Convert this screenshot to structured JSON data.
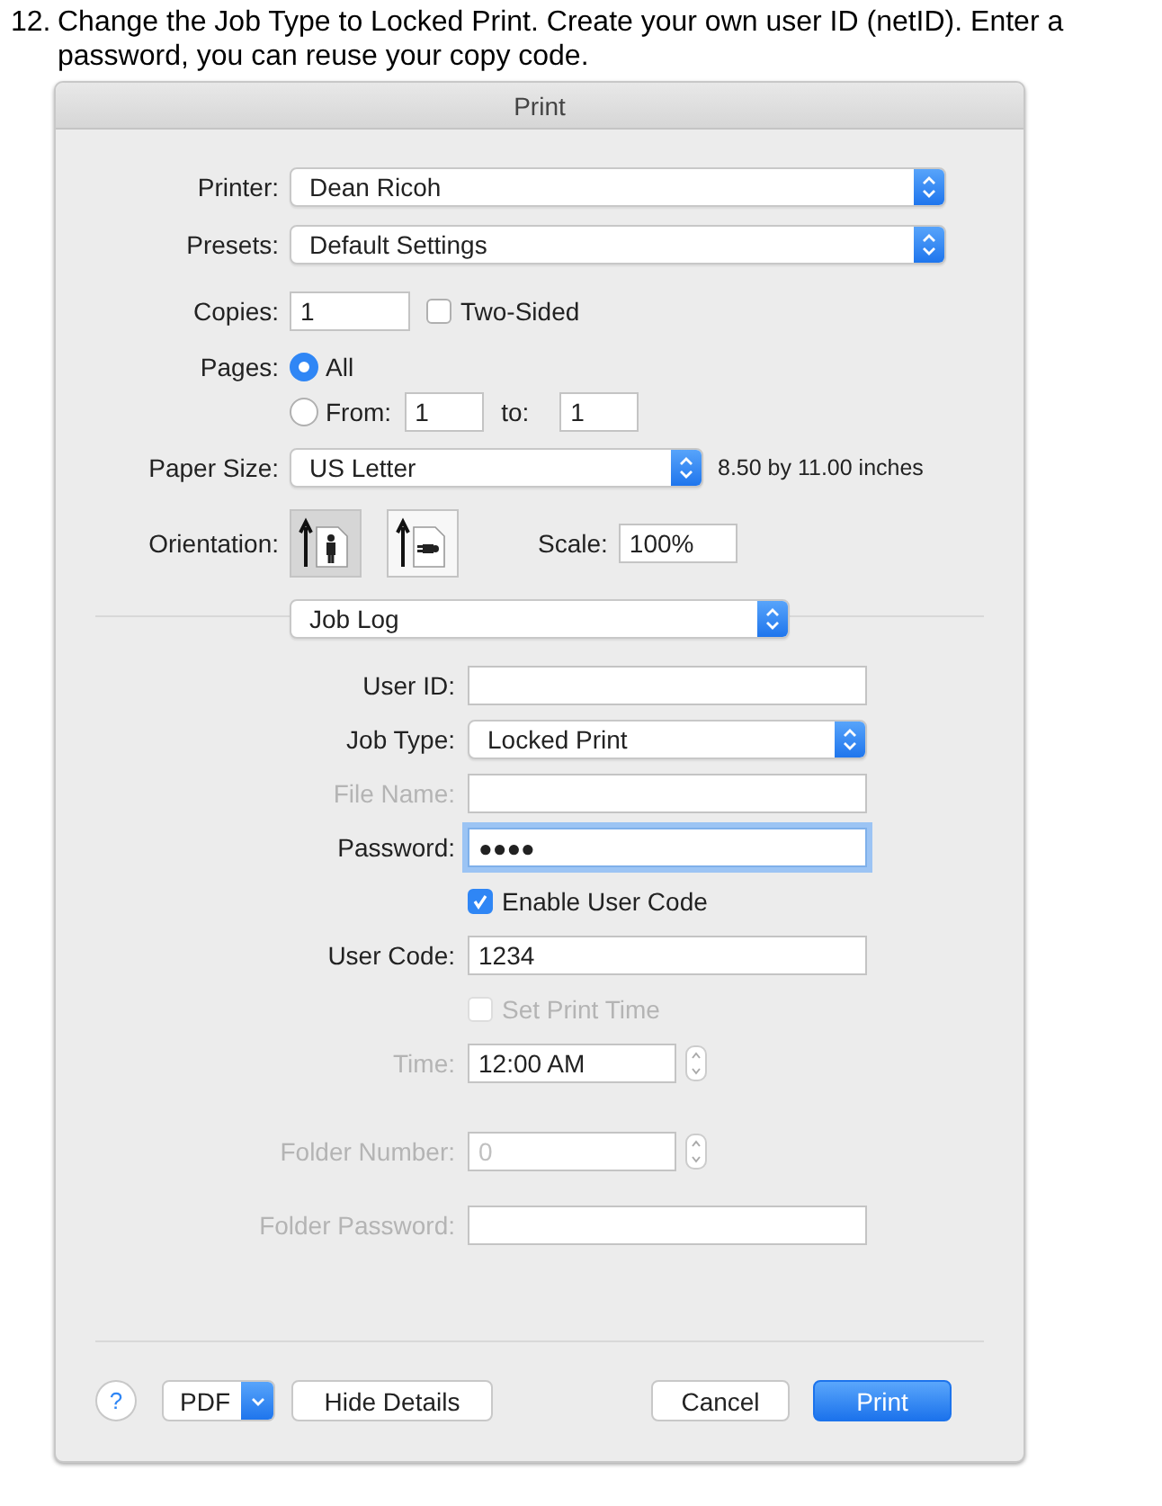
{
  "instruction": {
    "number": "12.",
    "text": "Change the Job Type to Locked Print. Create your own user ID (netID).  Enter a password, you can reuse your copy code."
  },
  "dialog": {
    "title": "Print",
    "printer": {
      "label": "Printer:",
      "value": "Dean Ricoh"
    },
    "presets": {
      "label": "Presets:",
      "value": "Default Settings"
    },
    "copies": {
      "label": "Copies:",
      "value": "1"
    },
    "two_sided": {
      "label": "Two-Sided",
      "checked": false
    },
    "pages": {
      "label": "Pages:",
      "options": [
        {
          "label": "All",
          "selected": true
        },
        {
          "label": "From:",
          "selected": false
        }
      ],
      "from": "1",
      "to_label": "to:",
      "to": "1"
    },
    "paper_size": {
      "label": "Paper Size:",
      "value": "US Letter",
      "dimensions": "8.50 by 11.00 inches"
    },
    "orientation": {
      "label": "Orientation:",
      "options": [
        {
          "kind": "portrait",
          "selected": true
        },
        {
          "kind": "landscape",
          "selected": false
        }
      ]
    },
    "scale": {
      "label": "Scale:",
      "value": "100%"
    },
    "panel": "Job Log",
    "fields": [
      {
        "kind": "text",
        "label": "User ID:",
        "disabled": false,
        "focused": false
      },
      {
        "kind": "popup",
        "label": "Job Type:",
        "value": "Locked Print",
        "disabled": false
      },
      {
        "kind": "text",
        "label": "File Name:",
        "disabled": true,
        "focused": false
      },
      {
        "kind": "text",
        "label": "Password:",
        "value": "●●●●",
        "disabled": false,
        "focused": true
      },
      {
        "kind": "checkbox",
        "label": "Enable User Code",
        "checked": true,
        "disabled": false
      },
      {
        "kind": "text",
        "label": "User Code:",
        "value": "1234",
        "disabled": false,
        "focused": false
      },
      {
        "kind": "checkbox",
        "label": "Set Print Time",
        "checked": false,
        "disabled": true
      },
      {
        "kind": "stepper",
        "label": "Time:",
        "value": "12:00 AM",
        "disabled": true,
        "value_disabled": false
      },
      {
        "kind": "stepper",
        "label": "Folder Number:",
        "value": "0",
        "disabled": true,
        "value_disabled": true
      },
      {
        "kind": "text",
        "label": "Folder Password:",
        "disabled": true,
        "focused": false
      }
    ],
    "buttons": {
      "help": "?",
      "pdf": "PDF",
      "hide_details": "Hide Details",
      "cancel": "Cancel",
      "print": "Print"
    }
  }
}
